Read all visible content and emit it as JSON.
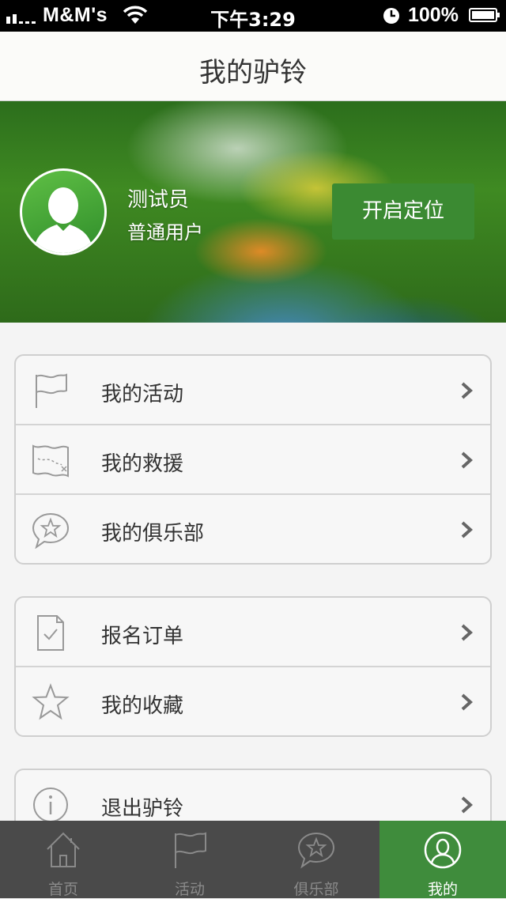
{
  "status_bar": {
    "carrier": "M&M's",
    "time": "下午3:29",
    "battery": "100%"
  },
  "nav": {
    "title": "我的驴铃"
  },
  "profile": {
    "username": "测试员",
    "role": "普通用户",
    "locate_button": "开启定位"
  },
  "menu_groups": [
    {
      "items": [
        {
          "label": "我的活动",
          "icon": "flag-icon"
        },
        {
          "label": "我的救援",
          "icon": "map-icon"
        },
        {
          "label": "我的俱乐部",
          "icon": "star-chat-icon"
        }
      ]
    },
    {
      "items": [
        {
          "label": "报名订单",
          "icon": "document-check-icon"
        },
        {
          "label": "我的收藏",
          "icon": "star-icon"
        }
      ]
    },
    {
      "items": [
        {
          "label": "退出驴铃",
          "icon": "info-icon"
        }
      ]
    }
  ],
  "tab_bar": {
    "tabs": [
      {
        "label": "首页",
        "icon": "home-icon",
        "active": false
      },
      {
        "label": "活动",
        "icon": "flag-icon",
        "active": false
      },
      {
        "label": "俱乐部",
        "icon": "star-chat-icon",
        "active": false
      },
      {
        "label": "我的",
        "icon": "user-icon",
        "active": true
      }
    ]
  },
  "colors": {
    "accent": "#3f8c3c",
    "tab_bar_bg": "#4a4a4a",
    "status_bar_bg": "#000000"
  }
}
